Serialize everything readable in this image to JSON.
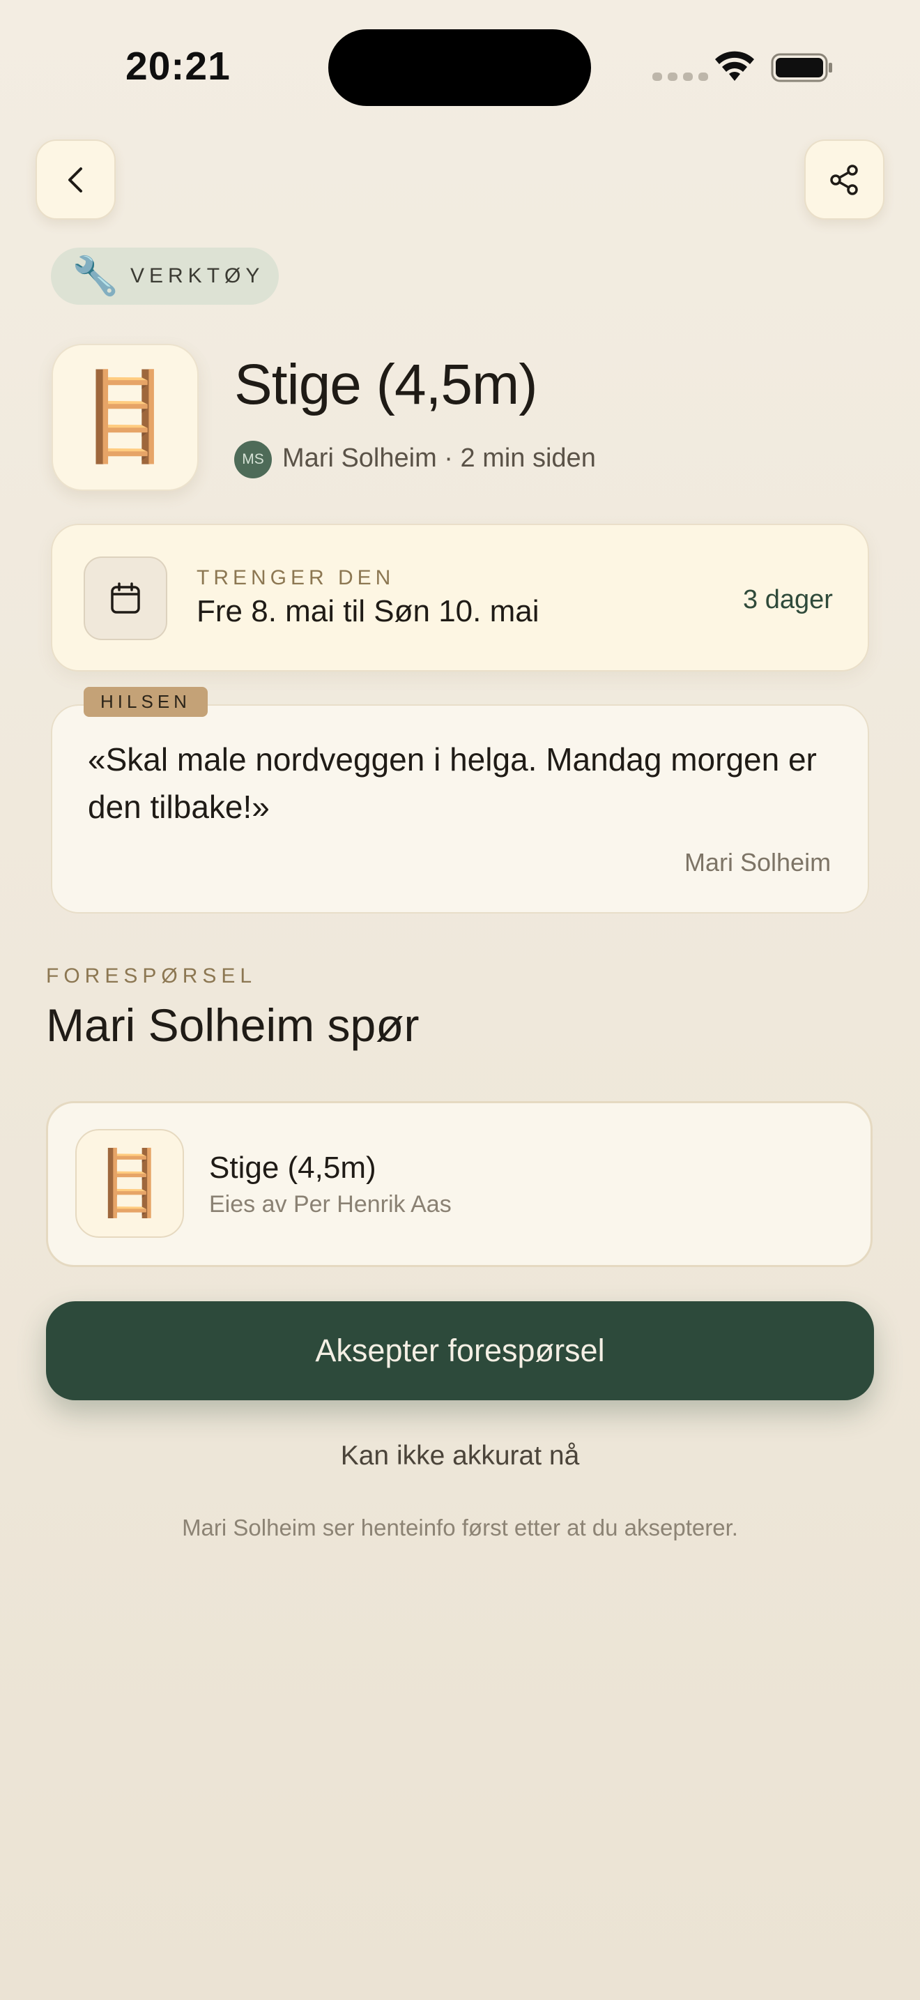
{
  "status_bar": {
    "time": "20:21"
  },
  "nav": {
    "back_icon": "chevron-left-icon",
    "share_icon": "share-icon"
  },
  "category": {
    "icon": "🔧",
    "label": "VERKTØY"
  },
  "item": {
    "icon": "🪜",
    "title": "Stige (4,5m)",
    "author_initials": "MS",
    "meta": "Mari Solheim · 2 min siden"
  },
  "dates": {
    "eyebrow": "TRENGER DEN",
    "range": "Fre 8. mai til Søn 10. mai",
    "duration": "3 dager"
  },
  "greeting": {
    "tag": "HILSEN",
    "text": "«Skal male nordveggen i helga. Mandag morgen er den tilbake!»",
    "signature": "Mari Solheim"
  },
  "request": {
    "eyebrow": "FORESPØRSEL",
    "title": "Mari Solheim spør",
    "item_icon": "🪜",
    "item_name": "Stige (4,5m)",
    "item_owner": "Eies av Per Henrik Aas"
  },
  "actions": {
    "accept": "Aksepter forespørsel",
    "decline": "Kan ikke akkurat nå",
    "footnote": "Mari Solheim ser henteinfo først etter at du aksepterer."
  },
  "colors": {
    "accent": "#2d4a3b",
    "card": "#fdf6e3",
    "tag": "#c4a277"
  }
}
